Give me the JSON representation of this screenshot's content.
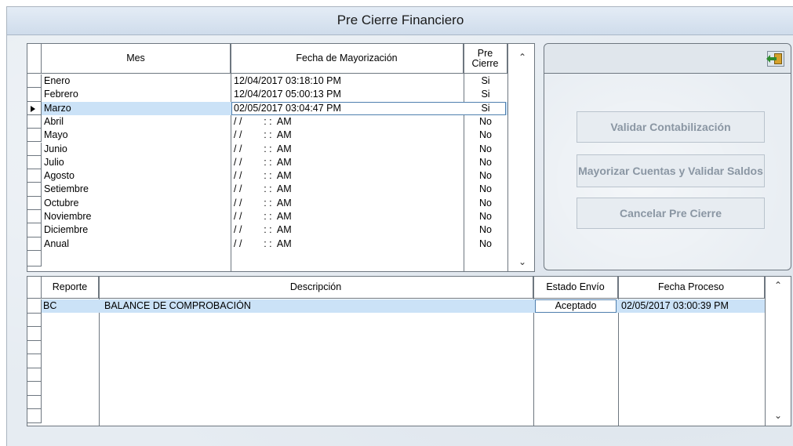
{
  "window": {
    "title": "Pre Cierre Financiero"
  },
  "months_grid": {
    "headers": {
      "mes": "Mes",
      "fecha": "Fecha de Mayorización",
      "pre": "Pre Cierre"
    },
    "rows": [
      {
        "mes": "Enero",
        "fecha": "12/04/2017 03:18:10 PM",
        "pre": "Si"
      },
      {
        "mes": "Febrero",
        "fecha": "12/04/2017 05:00:13 PM",
        "pre": "Si"
      },
      {
        "mes": "Marzo",
        "fecha": "02/05/2017 03:04:47 PM",
        "pre": "Si"
      },
      {
        "mes": "Abril",
        "fecha": "/ /        : :  AM",
        "pre": "No"
      },
      {
        "mes": "Mayo",
        "fecha": "/ /        : :  AM",
        "pre": "No"
      },
      {
        "mes": "Junio",
        "fecha": "/ /        : :  AM",
        "pre": "No"
      },
      {
        "mes": "Julio",
        "fecha": "/ /        : :  AM",
        "pre": "No"
      },
      {
        "mes": "Agosto",
        "fecha": "/ /        : :  AM",
        "pre": "No"
      },
      {
        "mes": "Setiembre",
        "fecha": "/ /        : :  AM",
        "pre": "No"
      },
      {
        "mes": "Octubre",
        "fecha": "/ /        : :  AM",
        "pre": "No"
      },
      {
        "mes": "Noviembre",
        "fecha": "/ /        : :  AM",
        "pre": "No"
      },
      {
        "mes": "Diciembre",
        "fecha": "/ /        : :  AM",
        "pre": "No"
      },
      {
        "mes": "Anual",
        "fecha": "/ /        : :  AM",
        "pre": "No"
      }
    ]
  },
  "actions": {
    "validar": "Validar Contabilización",
    "mayorizar": "Mayorizar Cuentas y Validar Saldos",
    "cancelar": "Cancelar Pre Cierre"
  },
  "report_grid": {
    "headers": {
      "reporte": "Reporte",
      "descripcion": "Descripción",
      "estado": "Estado Envío",
      "fecha": "Fecha Proceso"
    },
    "rows": [
      {
        "reporte": "BC",
        "descripcion": "BALANCE DE COMPROBACIÓN",
        "estado": "Aceptado",
        "fecha": "02/05/2017 03:00:39 PM"
      }
    ]
  },
  "icons": {
    "exit": "exit-door-icon",
    "scroll_up": "chevron-up-icon",
    "scroll_down": "chevron-down-icon",
    "row_pointer": "row-pointer-icon"
  },
  "colors": {
    "selection": "#cbe2f7",
    "window_bg": "#e6ecf2",
    "disabled_text": "#8a96a3"
  }
}
